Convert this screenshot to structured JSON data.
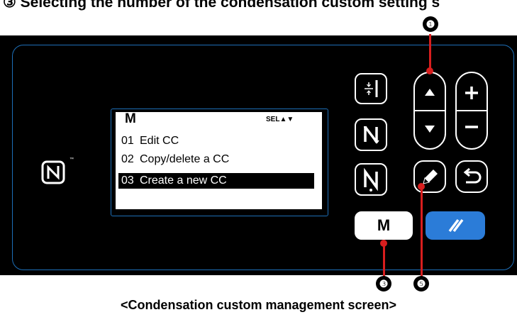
{
  "heading": "③ Selecting the number of the condensation custom setting s",
  "lcd": {
    "mode_letter": "M",
    "sel_indicator": "SEL▲▼",
    "items": [
      {
        "num": "01",
        "label": "Edit CC"
      },
      {
        "num": "02",
        "label": "Copy/delete a CC"
      },
      {
        "num": "03",
        "label": "Create a new CC"
      }
    ],
    "selected_index": 2
  },
  "buttons": {
    "m_label": "M",
    "plus_label": "+",
    "minus_label": "−"
  },
  "callouts": {
    "up_down": "❶",
    "m_key": "❸",
    "edit_key": "❺"
  },
  "caption": "<Condensation custom management screen>",
  "colors": {
    "panel": "#000000",
    "frame_blue": "#1d6fb8",
    "reset_button": "#2b7cd8",
    "leader_red": "#d81e1e"
  },
  "icons": [
    "nfc-icon",
    "half-stitch-icon",
    "reverse-stitch-icon",
    "needle-up-down-icon",
    "up-arrow-icon",
    "down-arrow-icon",
    "pencil-icon",
    "return-icon",
    "reset-icon"
  ]
}
